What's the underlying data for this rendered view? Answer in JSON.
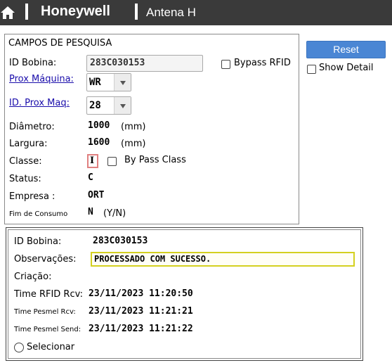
{
  "header": {
    "brand": "Honeywell",
    "app_title": "Antena H",
    "home_icon": "home-icon",
    "background": "#3a3a3a"
  },
  "search": {
    "title": "CAMPOS DE PESQUISA",
    "id_bobina_label": "ID Bobina:",
    "id_bobina_value": "283C030153",
    "bypass_rfid_label": "Bypass RFID",
    "bypass_rfid_checked": false,
    "prox_maquina_label": "Prox Máquina:",
    "prox_maquina_value": "WR",
    "id_prox_maq_label": "ID. Prox Maq:",
    "id_prox_maq_value": "28",
    "diametro_label": "Diâmetro:",
    "diametro_value": "1000",
    "diametro_unit": "(mm)",
    "largura_label": "Largura:",
    "largura_value": "1600",
    "largura_unit": "(mm)",
    "classe_label": "Classe:",
    "classe_value": "I",
    "by_pass_class_label": "By Pass Class",
    "by_pass_class_checked": false,
    "status_label": "Status:",
    "status_value": "C",
    "empresa_label": "Empresa :",
    "empresa_value": "ORT",
    "fim_consumo_label": "Fim de Consumo",
    "fim_consumo_value": "N",
    "fim_consumo_hint": "(Y/N)"
  },
  "actions": {
    "reset_label": "Reset",
    "show_detail_label": "Show Detail",
    "show_detail_checked": false,
    "accent": "#4a86d4"
  },
  "result": {
    "id_bobina_label": "ID Bobina:",
    "id_bobina_value": "283C030153",
    "observacoes_label": "Observações:",
    "observacoes_value": "PROCESSADO COM SUCESSO.",
    "criacao_label": "Criação:",
    "criacao_value": "",
    "time_rfid_label": "Time RFID Rcv:",
    "time_rfid_value": "23/11/2023 11:20:50",
    "time_pesmel_rcv_label": "Time Pesmel Rcv:",
    "time_pesmel_rcv_value": "23/11/2023 11:21:21",
    "time_pesmel_send_label": "Time Pesmel Send:",
    "time_pesmel_send_value": "23/11/2023 11:21:22",
    "selecionar_label": "Selecionar",
    "selecionar_checked": false
  }
}
